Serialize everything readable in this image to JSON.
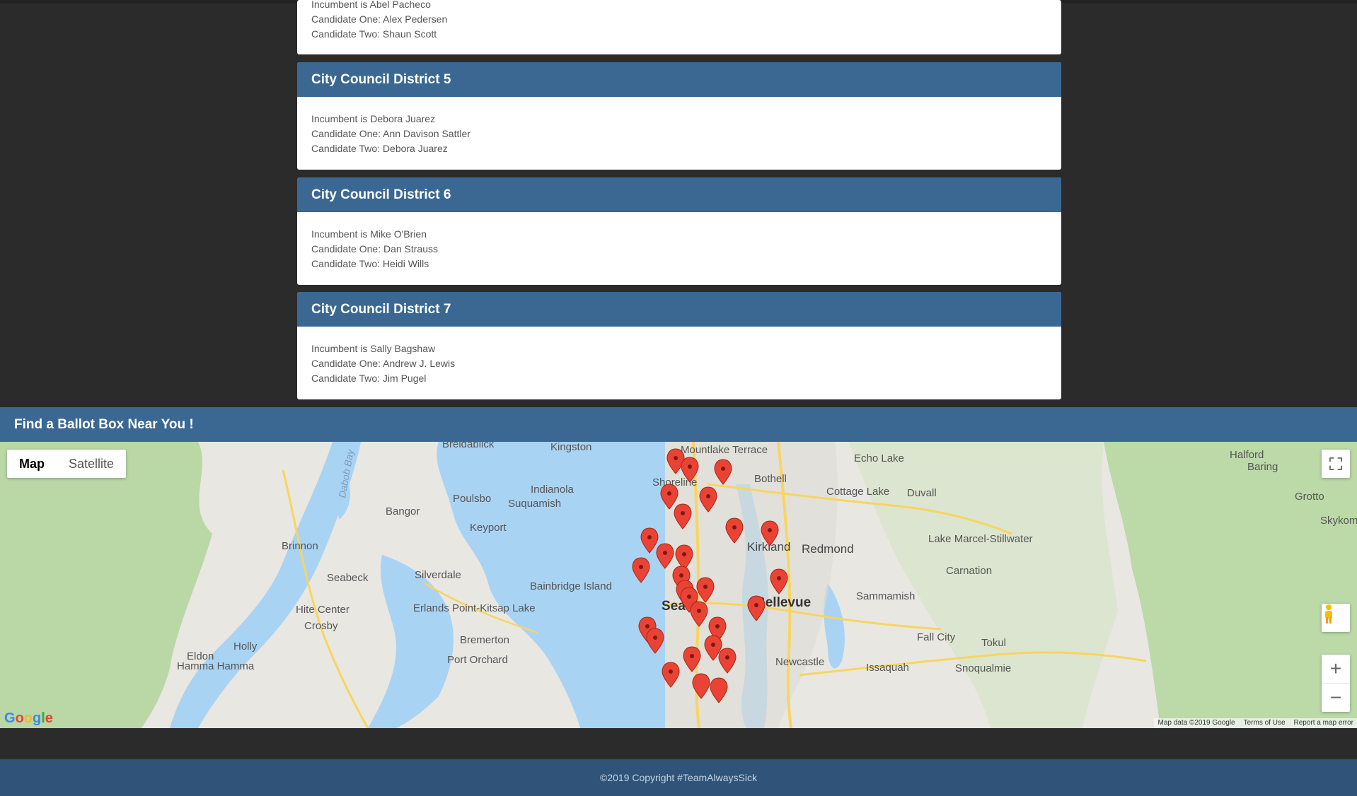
{
  "cards": [
    {
      "title": "",
      "lines": [
        "Incumbent is Abel Pacheco",
        "Candidate One: Alex Pedersen",
        "Candidate Two: Shaun Scott"
      ]
    },
    {
      "title": "City Council District 5",
      "lines": [
        "Incumbent is Debora Juarez",
        "Candidate One: Ann Davison Sattler",
        "Candidate Two: Debora Juarez"
      ]
    },
    {
      "title": "City Council District 6",
      "lines": [
        "Incumbent is Mike O'Brien",
        "Candidate One: Dan Strauss",
        "Candidate Two: Heidi Wills"
      ]
    },
    {
      "title": "City Council District 7",
      "lines": [
        "Incumbent is Sally Bagshaw",
        "Candidate One: Andrew J. Lewis",
        "Candidate Two: Jim Pugel"
      ]
    }
  ],
  "ballot_section": {
    "title": "Find a Ballot Box Near You !"
  },
  "map": {
    "type_buttons": {
      "map": "Map",
      "satellite": "Satellite"
    },
    "fullscreen_icon": "fullscreen-icon",
    "pegman_icon": "pegman-icon",
    "zoom_in_label": "+",
    "zoom_out_label": "−",
    "logo": "Google",
    "attribution": {
      "data": "Map data ©2019 Google",
      "terms": "Terms of Use",
      "report": "Report a map error"
    },
    "labels": {
      "bremerton": "Bremerton",
      "seattle": "Seattle",
      "bellevue": "Bellevue",
      "kirkland": "Kirkland",
      "redmond": "Redmond",
      "bothell": "Bothell",
      "shoreline": "Shoreline",
      "mountlake": "Mountlake Terrace",
      "kingston": "Kingston",
      "indianola": "Indianola",
      "suquamish": "Suquamish",
      "poulsbo": "Poulsbo",
      "keyport": "Keyport",
      "bangor": "Bangor",
      "brinnon": "Brinnon",
      "seabeck": "Seabeck",
      "silverdale": "Silverdale",
      "bainbridge": "Bainbridge Island",
      "erlands": "Erlands Point-Kitsap Lake",
      "hitecenter": "Hite Center",
      "crosby": "Crosby",
      "holly": "Holly",
      "eldon": "Eldon",
      "hamma": "Hamma Hamma",
      "portorchard": "Port Orchard",
      "breidablick": "Breidablick",
      "echolake": "Echo Lake",
      "cottagelake": "Cottage Lake",
      "duvall": "Duvall",
      "lakemarcel": "Lake Marcel-Stillwater",
      "carnation": "Carnation",
      "sammamish": "Sammamish",
      "fallcity": "Fall City",
      "tokul": "Tokul",
      "snoqualmie": "Snoqualmie",
      "issaquah": "Issaquah",
      "newcastle": "Newcastle",
      "halford": "Halford",
      "baring": "Baring",
      "grotto": "Grotto",
      "skykom": "Skykom",
      "dabob": "Dabob Bay"
    },
    "markers": 28
  },
  "footer": {
    "text": "©2019 Copyright #TeamAlwaysSick"
  }
}
